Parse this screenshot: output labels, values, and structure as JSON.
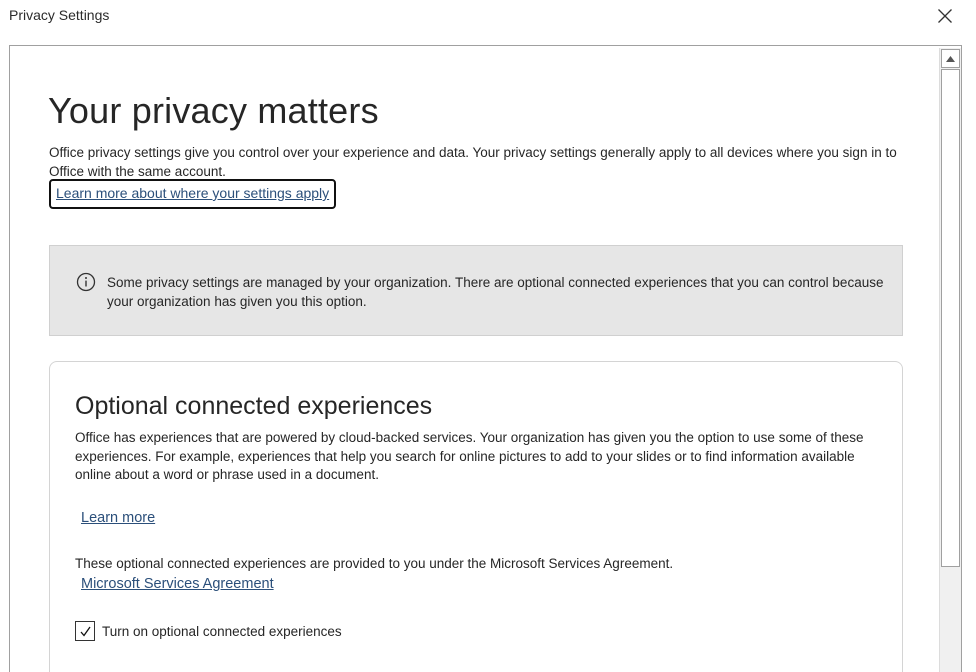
{
  "window": {
    "title": "Privacy Settings",
    "close_icon": "close-icon"
  },
  "header": {
    "title": "Your privacy matters",
    "intro": "Office privacy settings give you control over your experience and data. Your privacy settings generally apply to all devices where you sign in to Office with the same account.",
    "learn_link": "Learn more about where your settings apply"
  },
  "banner": {
    "icon": "info-icon",
    "text": "Some privacy settings are managed by your organization. There are optional connected experiences that you can control because your organization has given you this option."
  },
  "card": {
    "title": "Optional connected experiences",
    "description": "Office has experiences that are powered by cloud-backed services. Your organization has given you the option to use some of these experiences. For example, experiences that help you search for online pictures to add to your slides or to find information available online about a word or phrase used in a document.",
    "learn_more": "Learn more",
    "agreement_text": "These optional connected experiences are provided to you under the Microsoft Services Agreement.",
    "agreement_link": "Microsoft Services Agreement",
    "checkbox_label": "Turn on optional connected experiences",
    "checkbox_checked": true
  },
  "colors": {
    "link": "#2b4f7a",
    "banner_bg": "#e6e6e6"
  }
}
